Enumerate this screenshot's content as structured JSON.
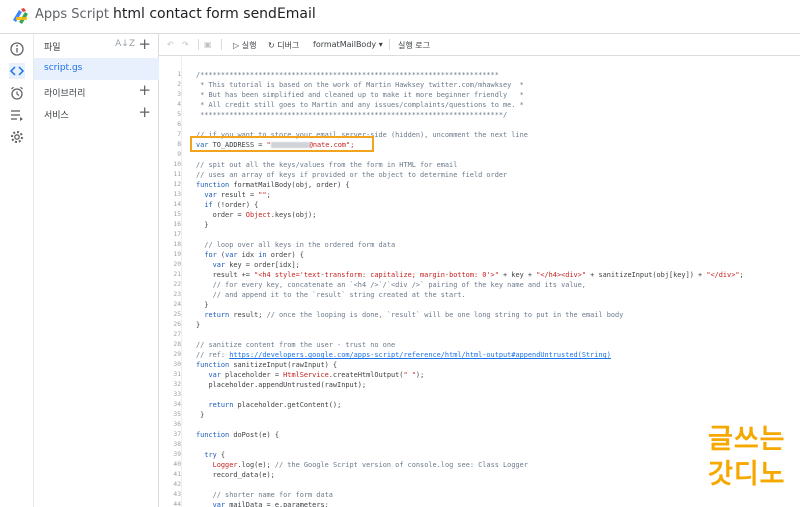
{
  "header": {
    "app_name": "Apps Script",
    "project_title": "html contact form sendEmail"
  },
  "files_panel": {
    "files_label": "파일",
    "file_name": "script.gs",
    "libraries_label": "라이브러리",
    "services_label": "서비스"
  },
  "toolbar": {
    "run_label": "실행",
    "debug_label": "디버그",
    "function_select": "formatMailBody",
    "log_label": "실행 로그"
  },
  "code": {
    "redacted_email_domain": "@nate.com\";"
  },
  "watermark": {
    "line1": "글쓰는",
    "line2": "갓디노"
  },
  "colors": {
    "accent": "#1a73e8",
    "highlight": "#f2a51c",
    "watermark": "#f6a800"
  }
}
